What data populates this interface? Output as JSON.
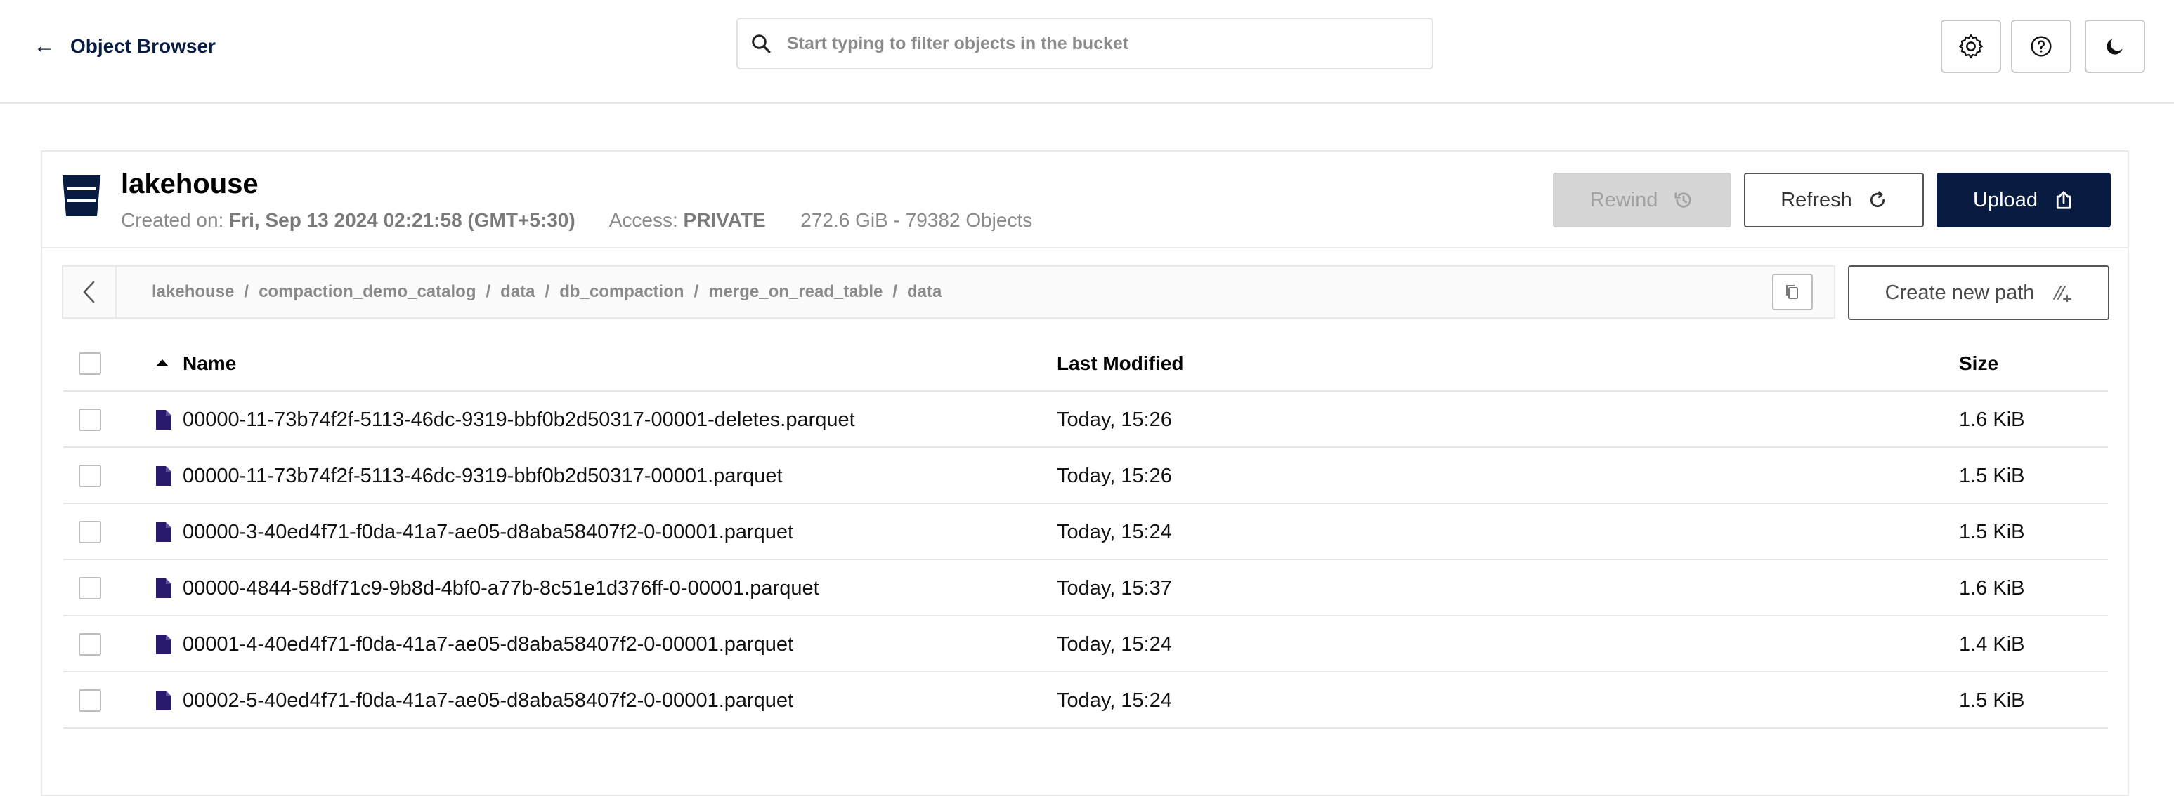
{
  "topbar": {
    "back_label": "Object Browser",
    "search_placeholder": "Start typing to filter objects in the bucket",
    "icons": [
      "settings-icon",
      "help-icon",
      "dark-mode-icon"
    ]
  },
  "bucket": {
    "name": "lakehouse",
    "created_label": "Created on:",
    "created_value": "Fri, Sep 13 2024 02:21:58 (GMT+5:30)",
    "access_label": "Access:",
    "access_value": "PRIVATE",
    "usage": "272.6 GiB - 79382 Objects"
  },
  "actions": {
    "rewind": "Rewind",
    "refresh": "Refresh",
    "upload": "Upload",
    "create_path": "Create new path"
  },
  "breadcrumb": [
    "lakehouse",
    "compaction_demo_catalog",
    "data",
    "db_compaction",
    "merge_on_read_table",
    "data"
  ],
  "table": {
    "headers": {
      "name": "Name",
      "modified": "Last Modified",
      "size": "Size"
    },
    "rows": [
      {
        "name": "00000-11-73b74f2f-5113-46dc-9319-bbf0b2d50317-00001-deletes.parquet",
        "modified": "Today, 15:26",
        "size": "1.6 KiB"
      },
      {
        "name": "00000-11-73b74f2f-5113-46dc-9319-bbf0b2d50317-00001.parquet",
        "modified": "Today, 15:26",
        "size": "1.5 KiB"
      },
      {
        "name": "00000-3-40ed4f71-f0da-41a7-ae05-d8aba58407f2-0-00001.parquet",
        "modified": "Today, 15:24",
        "size": "1.5 KiB"
      },
      {
        "name": "00000-4844-58df71c9-9b8d-4bf0-a77b-8c51e1d376ff-0-00001.parquet",
        "modified": "Today, 15:37",
        "size": "1.6 KiB"
      },
      {
        "name": "00001-4-40ed4f71-f0da-41a7-ae05-d8aba58407f2-0-00001.parquet",
        "modified": "Today, 15:24",
        "size": "1.4 KiB"
      },
      {
        "name": "00002-5-40ed4f71-f0da-41a7-ae05-d8aba58407f2-0-00001.parquet",
        "modified": "Today, 15:24",
        "size": "1.5 KiB"
      }
    ]
  },
  "colors": {
    "primary": "#081c42",
    "file_icon": "#2b1a6b",
    "muted": "#8a8a8a"
  }
}
